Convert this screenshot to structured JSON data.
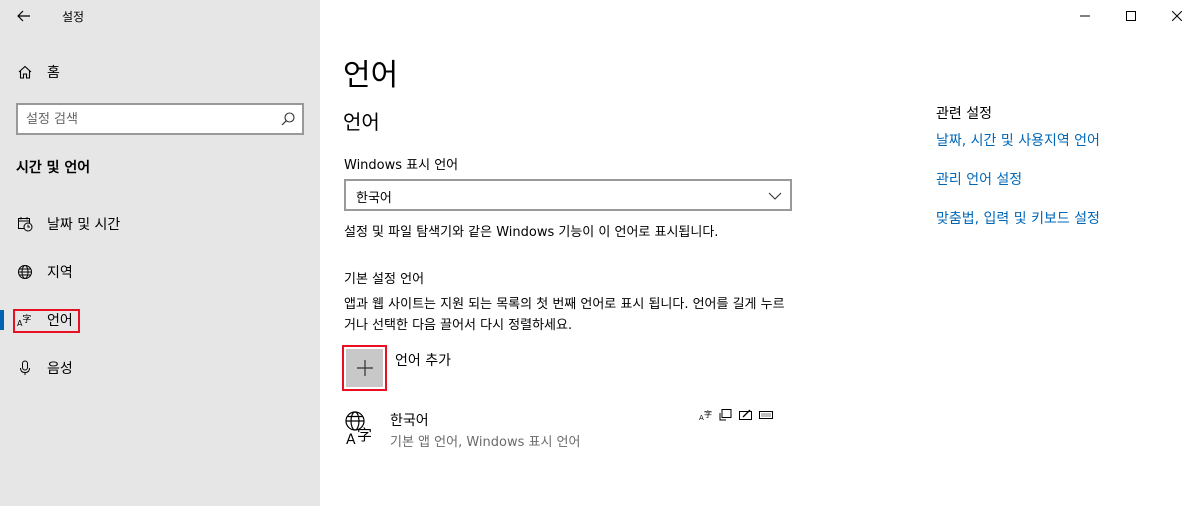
{
  "window": {
    "title": "설정",
    "controls": [
      "minimize",
      "maximize",
      "close"
    ]
  },
  "sidebar": {
    "home_label": "홈",
    "search_placeholder": "설정 검색",
    "section_title": "시간 및 언어",
    "items": [
      {
        "label": "날짜 및 시간",
        "icon": "date-time-icon"
      },
      {
        "label": "지역",
        "icon": "globe-icon"
      },
      {
        "label": "언어",
        "icon": "language-icon",
        "selected": true
      },
      {
        "label": "음성",
        "icon": "microphone-icon"
      }
    ]
  },
  "main": {
    "page_title": "언어",
    "language_section_title": "언어",
    "display_language_label": "Windows 표시 언어",
    "display_language_value": "한국어",
    "display_language_desc": "설정 및 파일 탐색기와 같은 Windows 기능이 이 언어로 표시됩니다.",
    "preferred_heading": "기본 설정 언어",
    "preferred_desc": "앱과 웹 사이트는 지원 되는 목록의 첫 번째 언어로 표시 됩니다. 언어를 길게 누르거나 선택한 다음 끌어서 다시 정렬하세요.",
    "add_language_label": "언어 추가",
    "languages": [
      {
        "name": "한국어",
        "detail": "기본 앱 언어, Windows 표시 언어"
      }
    ]
  },
  "related": {
    "heading": "관련 설정",
    "links": [
      "날짜, 시간 및 사용지역 언어",
      "관리 언어 설정",
      "맞춤법, 입력 및 키보드 설정"
    ]
  },
  "colors": {
    "accent": "#0063b1",
    "link": "#0067b8",
    "highlight": "#e81123",
    "sidebar_bg": "#e6e6e6"
  }
}
